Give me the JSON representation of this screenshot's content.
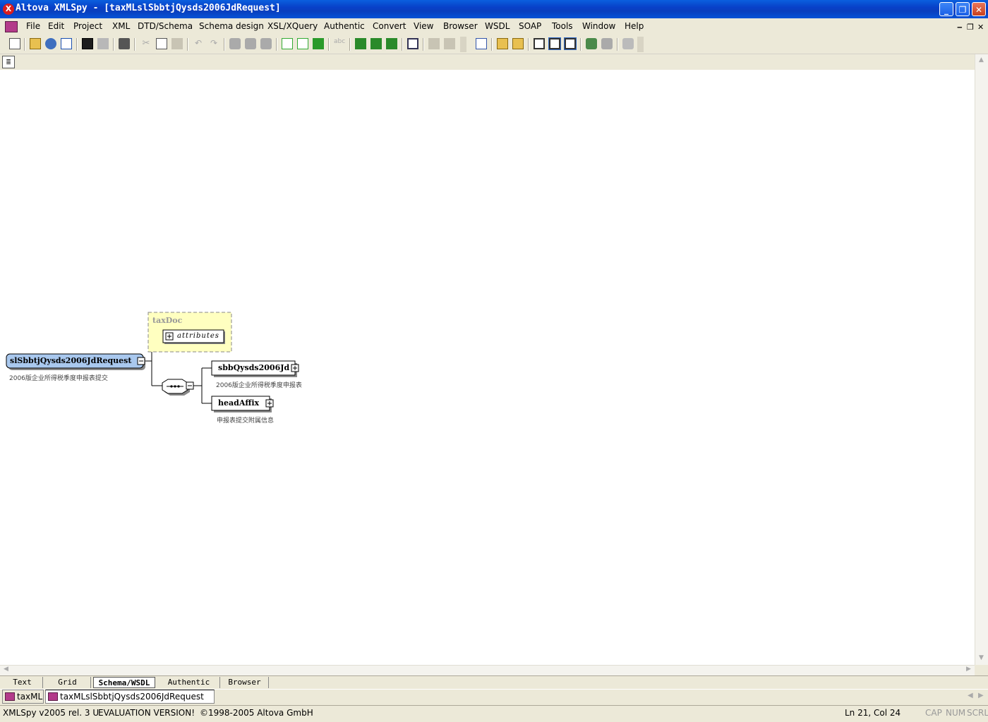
{
  "window": {
    "title": "Altova XMLSpy - [taxMLslSbbtjQysds2006JdRequest]",
    "icon": "xmlspy-app-icon",
    "controls": [
      "minimize-icon",
      "restore-icon",
      "close-icon"
    ]
  },
  "menu": {
    "items": [
      "File",
      "Edit",
      "Project",
      "XML",
      "DTD/Schema",
      "Schema design",
      "XSL/XQuery",
      "Authentic",
      "Convert",
      "View",
      "Browser",
      "WSDL",
      "SOAP",
      "Tools",
      "Window",
      "Help"
    ]
  },
  "toolbar": {
    "icons": [
      "new-file-icon",
      "open-icon",
      "open-url-icon",
      "reload-icon",
      "save-icon",
      "save-all-icon",
      "print-icon",
      "cut-icon",
      "copy-icon",
      "paste-icon",
      "undo-icon",
      "redo-icon",
      "find-icon",
      "find-next-icon",
      "replace-icon",
      "check-wellformed-icon",
      "validate-icon",
      "schema-assign-icon",
      "spellcheck-icon",
      "xsl-transform-icon",
      "xsl-fo-icon",
      "xquery-icon",
      "project-window-icon",
      "browser-icon",
      "text-view-icon",
      "grid-view-icon",
      "schema-view-icon",
      "authentic-view-icon",
      "browser-view-icon",
      "options-icon"
    ]
  },
  "diagram": {
    "root": {
      "name": "slSbbtjQysds2006JdRequest",
      "annotation": "2006版企业所得税季度申报表提交"
    },
    "type_box": {
      "name": "taxDoc",
      "attributes_label": "attributes"
    },
    "compositor": "sequence",
    "children": [
      {
        "name": "sbbQysds2006Jd",
        "annotation": "2006版企业所得税季度申报表"
      },
      {
        "name": "headAffix",
        "annotation": "申报表提交附属信息"
      }
    ]
  },
  "view_tabs": [
    "Text",
    "Grid",
    "Schema/WSDL",
    "Authentic",
    "Browser"
  ],
  "active_view_tab": "Schema/WSDL",
  "doc_tabs": [
    {
      "label": "taxML"
    },
    {
      "label": "taxMLslSbbtjQysds2006JdRequest"
    }
  ],
  "status": {
    "version": "XMLSpy v2005 rel. 3 U",
    "eval": "EVALUATION VERSION!",
    "copyright": "©1998-2005 Altova GmbH",
    "position": "Ln 21, Col 24",
    "cap": "CAP",
    "num": "NUM",
    "scrl": "SCRL"
  }
}
